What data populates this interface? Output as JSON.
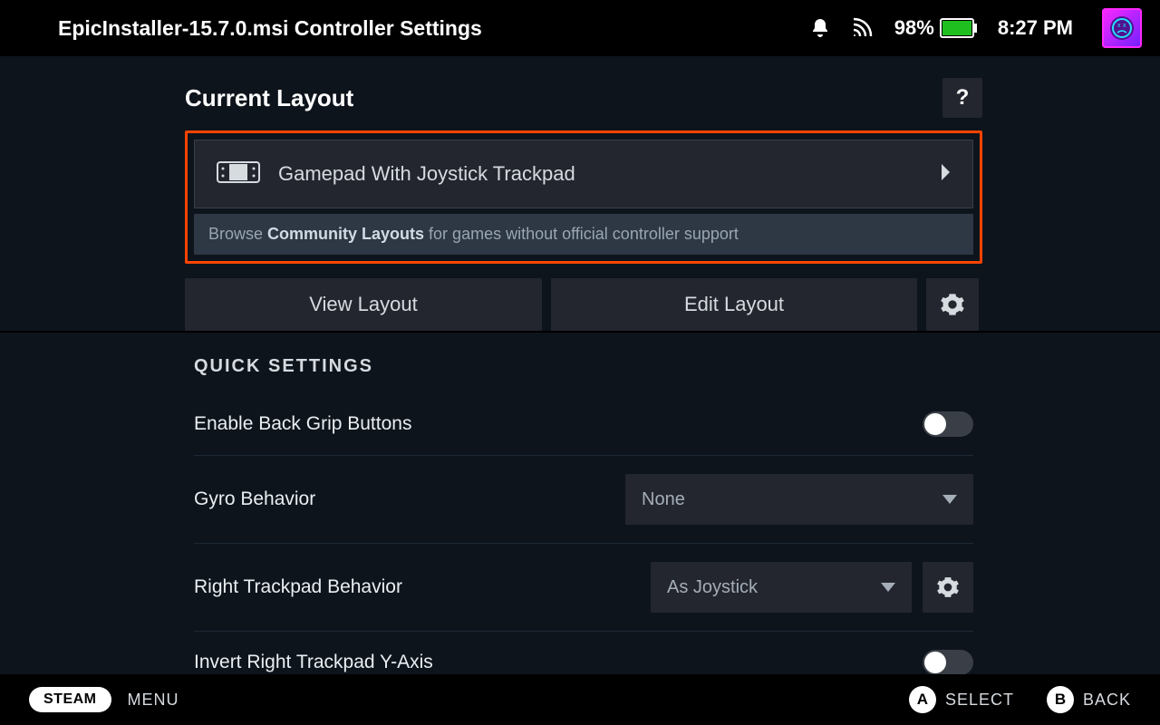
{
  "topbar": {
    "title": "EpicInstaller-15.7.0.msi Controller Settings",
    "battery_pct": "98%",
    "clock": "8:27 PM"
  },
  "layout": {
    "heading": "Current Layout",
    "help_char": "?",
    "name": "Gamepad With Joystick Trackpad",
    "browse_prefix": "Browse ",
    "browse_bold": "Community Layouts",
    "browse_suffix": " for games without official controller support",
    "view_label": "View Layout",
    "edit_label": "Edit Layout"
  },
  "quick": {
    "title": "QUICK SETTINGS",
    "rows": [
      {
        "label": "Enable Back Grip Buttons",
        "type": "toggle",
        "on": false
      },
      {
        "label": "Gyro Behavior",
        "type": "dropdown_wide",
        "value": "None"
      },
      {
        "label": "Right Trackpad Behavior",
        "type": "dropdown_narrow_gear",
        "value": "As Joystick"
      },
      {
        "label": "Invert Right Trackpad Y-Axis",
        "type": "toggle",
        "on": false
      }
    ]
  },
  "footer": {
    "steam": "STEAM",
    "menu": "MENU",
    "select_glyph": "A",
    "select_label": "SELECT",
    "back_glyph": "B",
    "back_label": "BACK"
  }
}
